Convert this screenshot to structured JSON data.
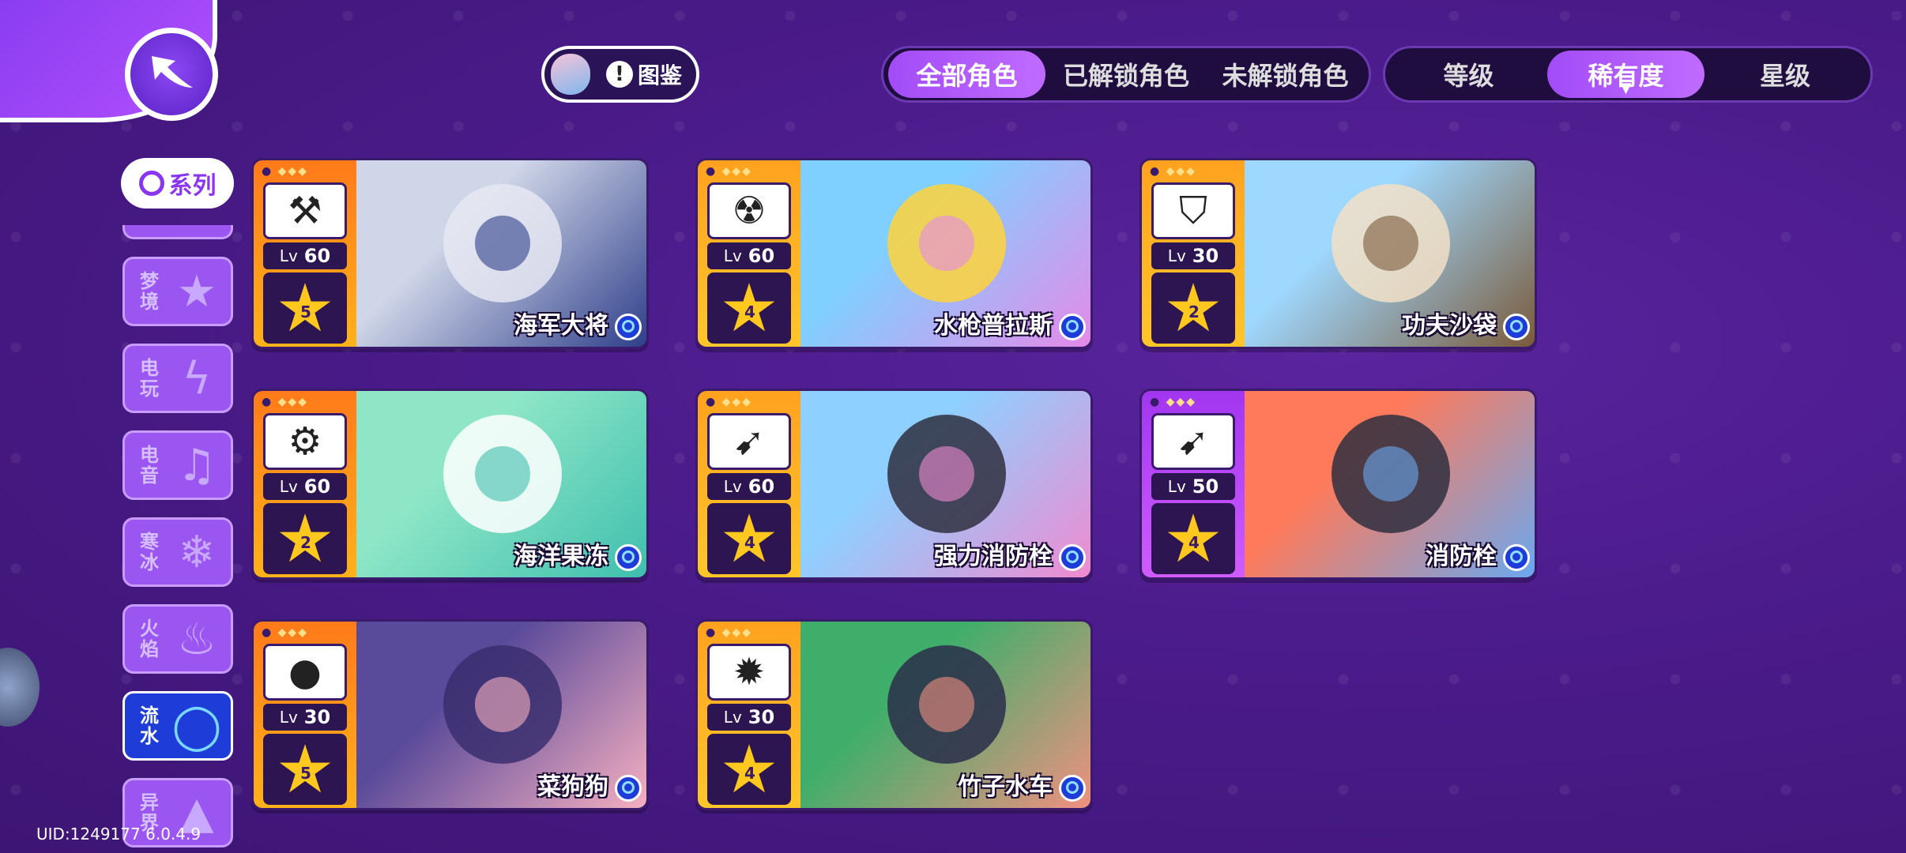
{
  "topbar": {
    "codex_label": "图鉴",
    "filter_tabs": [
      "全部角色",
      "已解锁角色",
      "未解锁角色"
    ],
    "filter_active": 0,
    "sort_tabs": [
      "等级",
      "稀有度",
      "星级"
    ],
    "sort_active": 1
  },
  "sidebar": {
    "series_label": "系列",
    "categories": [
      {
        "label": "梦境",
        "icon": "star-icon"
      },
      {
        "label": "电玩",
        "icon": "lightning-icon"
      },
      {
        "label": "电音",
        "icon": "music-note-icon"
      },
      {
        "label": "寒冰",
        "icon": "snowflake-icon"
      },
      {
        "label": "火焰",
        "icon": "flame-icon"
      },
      {
        "label": "流水",
        "icon": "water-drop-icon"
      },
      {
        "label": "异界",
        "icon": "triangle-icon"
      }
    ],
    "active_category": 5
  },
  "cards": [
    {
      "name": "海军大将",
      "level": "60",
      "star": "5",
      "class_icon": "hammer-icon",
      "frame": "orange"
    },
    {
      "name": "水枪普拉斯",
      "level": "60",
      "star": "4",
      "class_icon": "radiation-icon",
      "frame": "gold"
    },
    {
      "name": "功夫沙袋",
      "level": "30",
      "star": "2",
      "class_icon": "shield-icon",
      "frame": "gold"
    },
    {
      "name": "海洋果冻",
      "level": "60",
      "star": "2",
      "class_icon": "gear-bulb-icon",
      "frame": "orange"
    },
    {
      "name": "强力消防栓",
      "level": "60",
      "star": "4",
      "class_icon": "bow-icon",
      "frame": "gold"
    },
    {
      "name": "消防栓",
      "level": "50",
      "star": "4",
      "class_icon": "bow-icon",
      "frame": "purple"
    },
    {
      "name": "菜狗狗",
      "level": "30",
      "star": "5",
      "class_icon": "bomb-icon",
      "frame": "orange"
    },
    {
      "name": "竹子水车",
      "level": "30",
      "star": "4",
      "class_icon": "sun-icon",
      "frame": "gold"
    }
  ],
  "lv_prefix": "Lv",
  "footer": {
    "uid": "UID:1249177 6.0.4.9"
  }
}
